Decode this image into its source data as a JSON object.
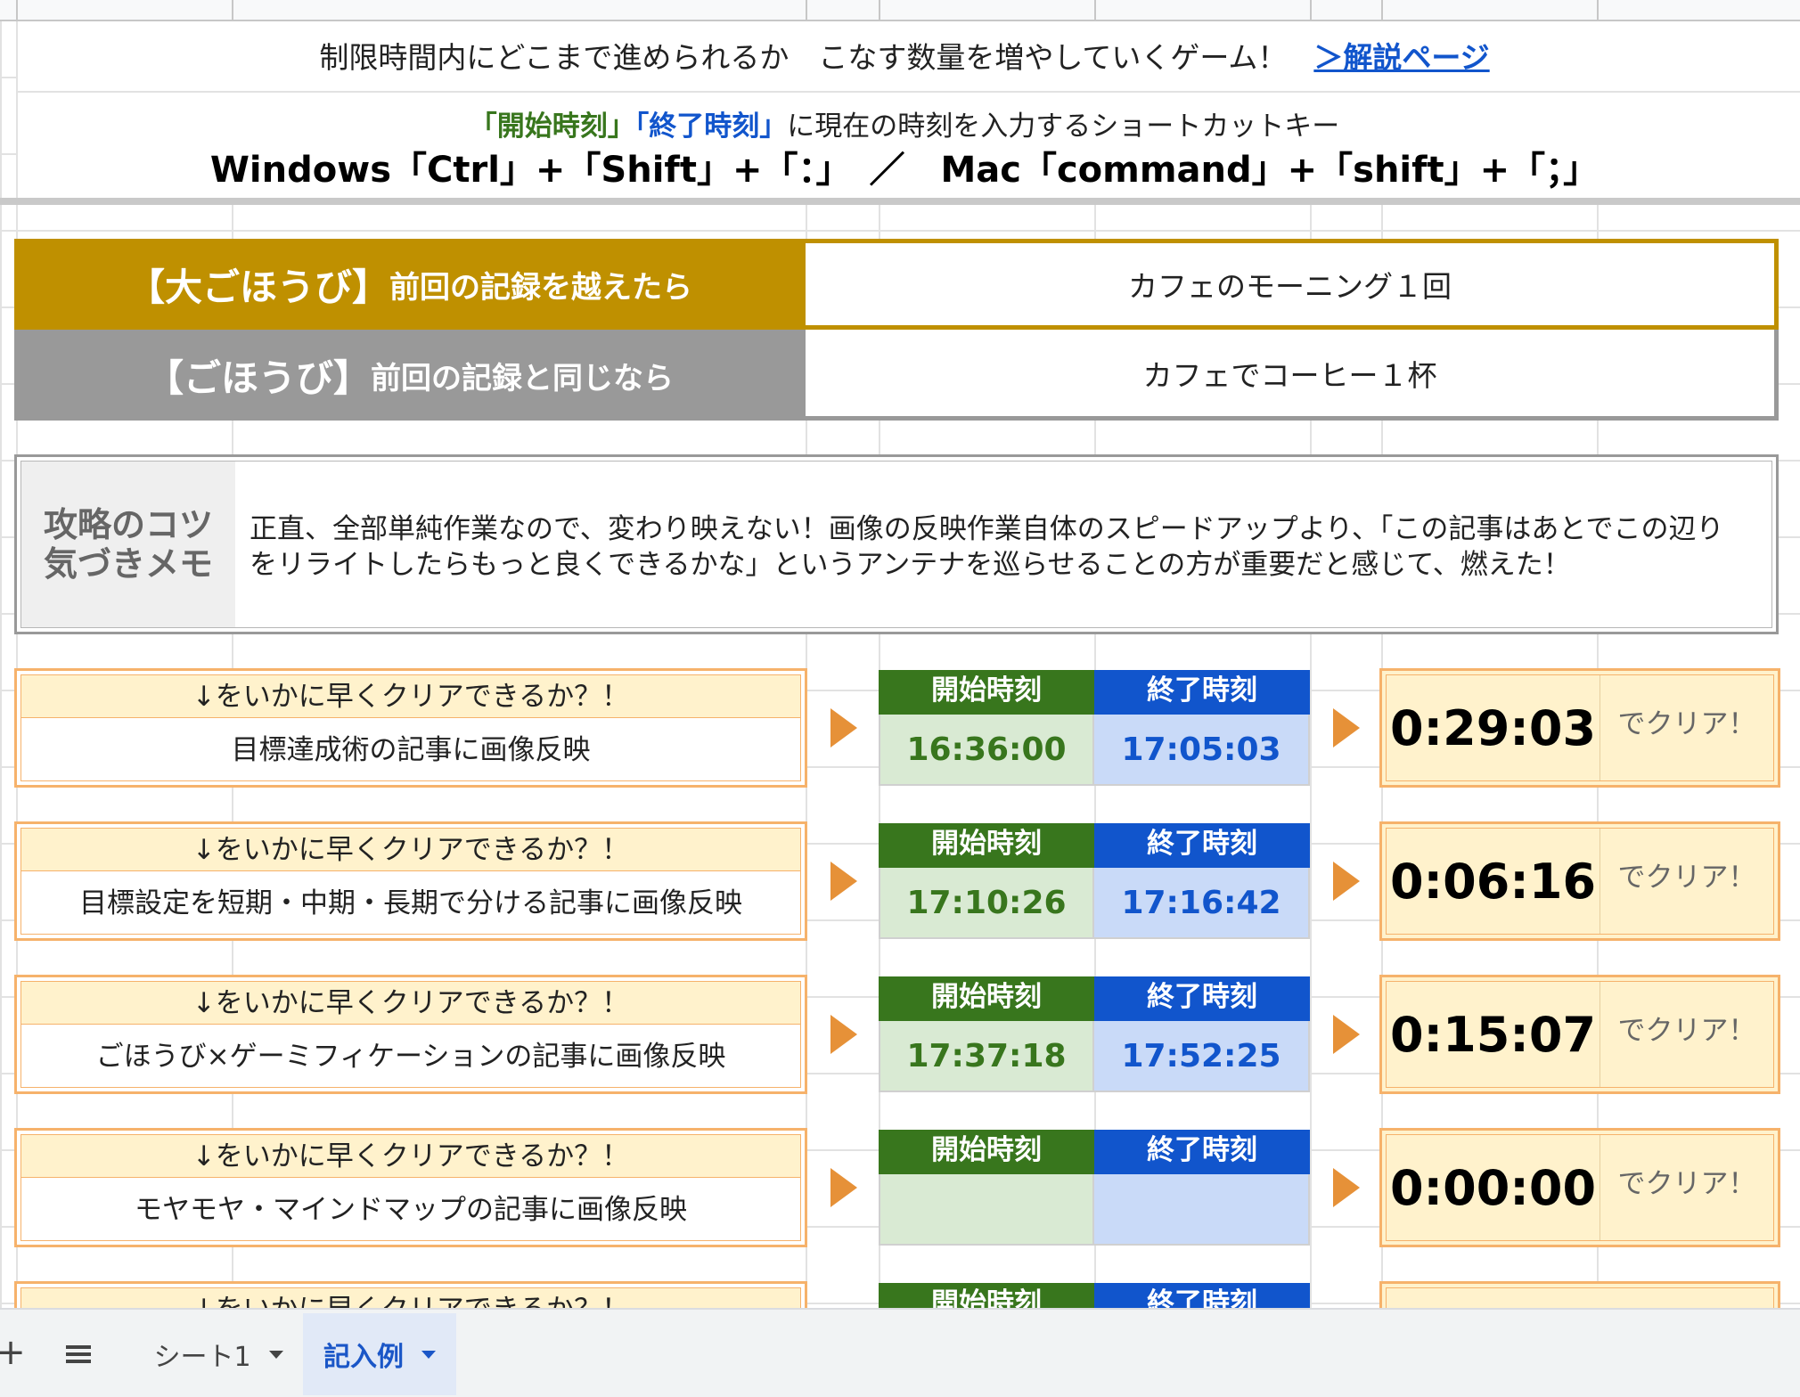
{
  "header": {
    "description": "制限時間内にどこまで進められるか　こなす数量を増やしていくゲーム！",
    "link_text": "＞解説ページ",
    "shortcut_start_label": "「開始時刻」",
    "shortcut_end_label": "「終了時刻」",
    "shortcut_text": "に現在の時刻を入力するショートカットキー",
    "shortcut_keys": "Windows「Ctrl」+「Shift」+「：」　／　Mac「command」+「shift」+「；」"
  },
  "rewards": {
    "big": {
      "label_bracket": "【大ごほうび】",
      "label_condition": "前回の記録を越えたら",
      "value": "カフェのモーニング１回"
    },
    "normal": {
      "label_bracket": "【ごほうび】",
      "label_condition": "前回の記録と同じなら",
      "value": "カフェでコーヒー１杯"
    }
  },
  "memo": {
    "label_line1": "攻略のコツ",
    "label_line2": "気づきメモ",
    "text": "正直、全部単純作業なので、変わり映えない！画像の反映作業自体のスピードアップより、「この記事はあとでこの辺りをリライトしたらもっと良くできるかな」というアンテナを巡らせることの方が重要だと感じて、燃えた！"
  },
  "tasks": [
    {
      "header": "↓をいかに早くクリアできるか？！",
      "name": "目標達成術の記事に画像反映",
      "start_label": "開始時刻",
      "end_label": "終了時刻",
      "start": "16:36:00",
      "end": "17:05:03",
      "duration": "0:29:03",
      "suffix": "でクリア！"
    },
    {
      "header": "↓をいかに早くクリアできるか？！",
      "name": "目標設定を短期・中期・長期で分ける記事に画像反映",
      "start_label": "開始時刻",
      "end_label": "終了時刻",
      "start": "17:10:26",
      "end": "17:16:42",
      "duration": "0:06:16",
      "suffix": "でクリア！"
    },
    {
      "header": "↓をいかに早くクリアできるか？！",
      "name": "ごほうび×ゲーミフィケーションの記事に画像反映",
      "start_label": "開始時刻",
      "end_label": "終了時刻",
      "start": "17:37:18",
      "end": "17:52:25",
      "duration": "0:15:07",
      "suffix": "でクリア！"
    },
    {
      "header": "↓をいかに早くクリアできるか？！",
      "name": "モヤモヤ・マインドマップの記事に画像反映",
      "start_label": "開始時刻",
      "end_label": "終了時刻",
      "start": "",
      "end": "",
      "duration": "0:00:00",
      "suffix": "でクリア！"
    },
    {
      "header": "↓をいかに早くクリアできるか？！",
      "name": "",
      "start_label": "開始時刻",
      "end_label": "終了時刻",
      "start": "",
      "end": "",
      "duration": "",
      "suffix": ""
    }
  ],
  "sheet_tabs": [
    {
      "label": "シート1"
    },
    {
      "label": "記入例"
    }
  ],
  "colors": {
    "big_reward": "#bf9000",
    "reward": "#999999",
    "start_green": "#38761d",
    "end_blue": "#1155cc",
    "task_orange": "#f6b26b",
    "arrow_orange": "#e69138"
  }
}
